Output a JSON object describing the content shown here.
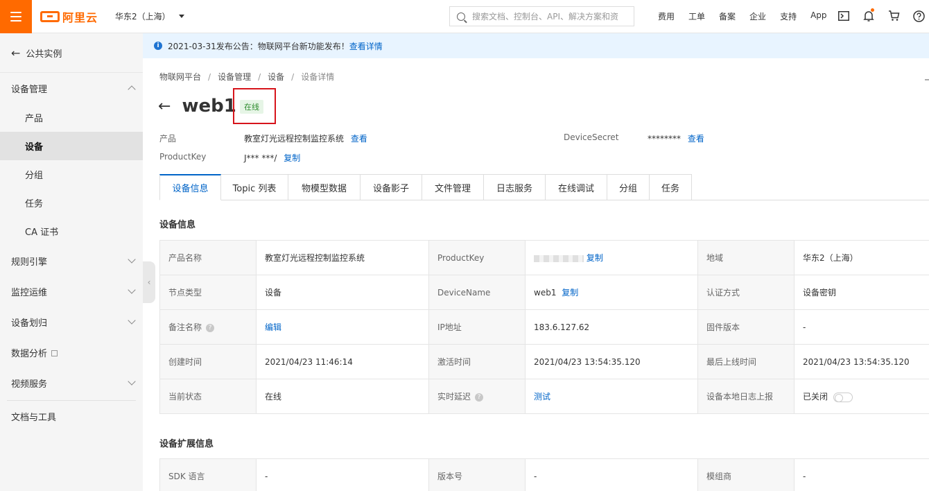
{
  "topbar": {
    "logo_text": "阿里云",
    "region": "华东2（上海）",
    "search_placeholder": "搜索文档、控制台、API、解决方案和资",
    "links": [
      "费用",
      "工单",
      "备案",
      "企业",
      "支持",
      "App"
    ],
    "brand_color": "#ff6a00"
  },
  "sidebar": {
    "back_label": "公共实例",
    "device_mgmt": "设备管理",
    "sub_items": [
      "产品",
      "设备",
      "分组",
      "任务",
      "CA 证书"
    ],
    "active_item": "设备",
    "groups": [
      "规则引擎",
      "监控运维",
      "设备划归",
      "数据分析",
      "视频服务"
    ],
    "docs": "文档与工具"
  },
  "notice": {
    "text": "2021-03-31发布公告：物联网平台新功能发布！",
    "link": "查看详情"
  },
  "breadcrumb": [
    "物联网平台",
    "设备管理",
    "设备",
    "设备详情"
  ],
  "device": {
    "name": "web1",
    "status": "在线",
    "product_label": "产品",
    "product_value": "教室灯光远程控制监控系统",
    "view": "查看",
    "productkey_label": "ProductKey",
    "productkey_value": "J*** ***/",
    "copy": "复制",
    "secret_label": "DeviceSecret",
    "secret_value": "********"
  },
  "tabs": [
    "设备信息",
    "Topic 列表",
    "物模型数据",
    "设备影子",
    "文件管理",
    "日志服务",
    "在线调试",
    "分组",
    "任务"
  ],
  "info_section": {
    "title": "设备信息",
    "rows": [
      [
        "产品名称",
        "教室灯光远程控制监控系统",
        "ProductKey",
        "",
        "地域",
        "华东2（上海）"
      ],
      [
        "节点类型",
        "设备",
        "DeviceName",
        "web1",
        "认证方式",
        "设备密钥"
      ],
      [
        "备注名称",
        "编辑",
        "IP地址",
        "183.6.127.62",
        "固件版本",
        "-"
      ],
      [
        "创建时间",
        "2021/04/23 11:46:14",
        "激活时间",
        "2021/04/23 13:54:35.120",
        "最后上线时间",
        "2021/04/23 13:54:35.120"
      ],
      [
        "当前状态",
        "在线",
        "实时延迟",
        "测试",
        "设备本地日志上报",
        "已关闭"
      ]
    ]
  },
  "ext_section": {
    "title": "设备扩展信息",
    "rows": [
      [
        "SDK 语言",
        "-",
        "版本号",
        "-",
        "模组商",
        "-"
      ]
    ]
  },
  "colors": {
    "link": "#0064c8",
    "highlight_box": "#d6141b",
    "online_green": "#2b8a2b"
  }
}
